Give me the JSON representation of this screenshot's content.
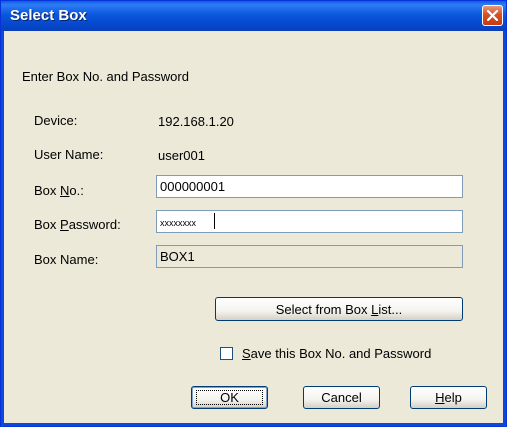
{
  "window": {
    "title": "Select Box"
  },
  "instruction": "Enter Box No. and Password",
  "fields": {
    "device": {
      "label": "Device:",
      "value": "192.168.1.20"
    },
    "user_name": {
      "label": "User Name:",
      "value": "user001"
    },
    "box_no": {
      "label_pre": "Box ",
      "label_key": "N",
      "label_post": "o.:",
      "value": "000000001"
    },
    "box_password": {
      "label_pre": "Box ",
      "label_key": "P",
      "label_post": "assword:",
      "value": "xxxxxxxx"
    },
    "box_name": {
      "label": "Box Name:",
      "value": "BOX1"
    }
  },
  "select_list_button": {
    "label_pre": "Select from Box ",
    "label_key": "L",
    "label_post": "ist..."
  },
  "save_checkbox": {
    "checked": false,
    "label_key": "S",
    "label_post": "ave this Box No. and Password"
  },
  "buttons": {
    "ok": "OK",
    "cancel": "Cancel",
    "help_key": "H",
    "help_post": "elp"
  },
  "colors": {
    "titlebar": "#0a58dc",
    "dialog": "#ece9d8",
    "close": "#d5502a"
  }
}
